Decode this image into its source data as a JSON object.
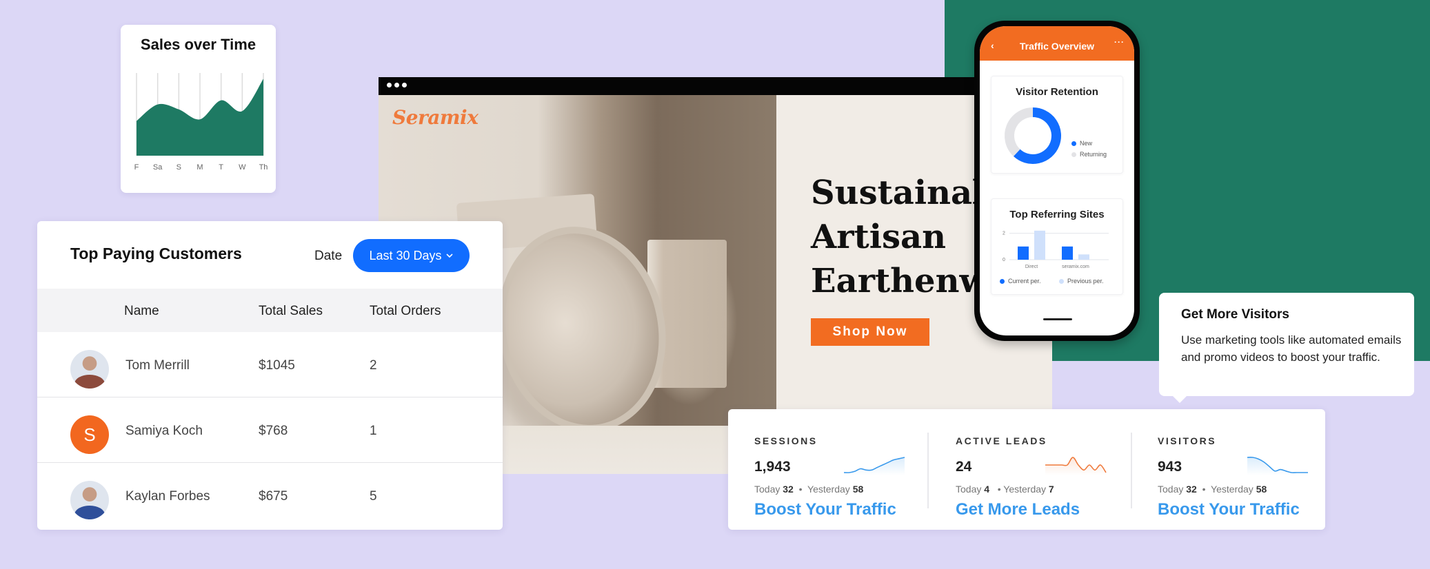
{
  "colors": {
    "background": "#dcd7f6",
    "green_block": "#1e7a63",
    "brand_orange": "#f26c21",
    "primary_blue": "#116dff",
    "link_blue": "#3899ec",
    "area_green": "#1e7a63"
  },
  "sales_card": {
    "title": "Sales over Time",
    "chart_data": {
      "type": "area",
      "title": "Sales over Time",
      "categories": [
        "F",
        "Sa",
        "S",
        "M",
        "T",
        "W",
        "Th"
      ],
      "values": [
        42,
        62,
        56,
        44,
        67,
        54,
        93
      ],
      "ylim": [
        0,
        100
      ],
      "grid": "vertical",
      "xlabel": "",
      "ylabel": ""
    }
  },
  "website": {
    "window_icon": "three-dots-icon",
    "logo": "Seramix",
    "hero_lines": [
      "Sustainable",
      "Artisan",
      "Earthenware"
    ],
    "cta_label": "Shop Now"
  },
  "phone": {
    "header_title": "Traffic Overview",
    "back_icon": "‹",
    "more_icon": "···",
    "retention": {
      "title": "Visitor Retention",
      "chart_data": {
        "type": "pie",
        "title": "Visitor Retention",
        "categories": [
          "New",
          "Returning"
        ],
        "values": [
          62,
          38
        ],
        "colors": [
          "#116dff",
          "#e3e3e6"
        ]
      }
    },
    "referring": {
      "title": "Top Referring Sites",
      "chart_data": {
        "type": "bar",
        "title": "Top Referring Sites",
        "categories": [
          "Direct",
          "seramix.com"
        ],
        "series": [
          {
            "name": "Current per.",
            "values": [
              1,
              1
            ],
            "color": "#116dff"
          },
          {
            "name": "Previous per.",
            "values": [
              2.2,
              0.4
            ],
            "color": "#cfe0fb"
          }
        ],
        "y_ticks": [
          "0",
          "2"
        ],
        "ylim": [
          0,
          2.4
        ]
      }
    }
  },
  "tooltip": {
    "title": "Get More Visitors",
    "body": "Use marketing tools like automated emails and promo videos to boost your traffic."
  },
  "customers": {
    "title": "Top Paying Customers",
    "date_label": "Date",
    "date_value": "Last 30 Days",
    "columns": [
      "Name",
      "Total Sales",
      "Total Orders"
    ],
    "rows": [
      {
        "avatar": "photo",
        "avatar_letter": "",
        "name": "Tom Merrill",
        "sales": "$1045",
        "orders": "2"
      },
      {
        "avatar": "letter",
        "avatar_letter": "S",
        "name": "Samiya Koch",
        "sales": "$768",
        "orders": "1"
      },
      {
        "avatar": "photo",
        "avatar_letter": "",
        "name": "Kaylan Forbes",
        "sales": "$675",
        "orders": "5"
      }
    ]
  },
  "stats": [
    {
      "label": "SESSIONS",
      "value": "1,943",
      "today_label": "Today",
      "today": "32",
      "yesterday_label": "Yesterday",
      "yesterday": "58",
      "link": "Boost Your Traffic",
      "trend_color": "#3899ec",
      "trend": [
        3,
        3,
        4,
        6,
        5,
        5,
        7,
        9,
        11,
        13,
        14,
        15
      ]
    },
    {
      "label": "ACTIVE LEADS",
      "value": "24",
      "today_label": "Today",
      "today": "4",
      "yesterday_label": "Yesterday",
      "yesterday": "7",
      "link": "Get More Leads",
      "trend_color": "#ef7a3c",
      "trend": [
        9,
        9,
        9,
        9,
        9,
        12,
        9,
        7,
        9,
        7,
        9,
        6
      ]
    },
    {
      "label": "VISITORS",
      "value": "943",
      "today_label": "Today",
      "today": "32",
      "yesterday_label": "Yesterday",
      "yesterday": "58",
      "link": "Boost Your Traffic",
      "trend_color": "#3899ec",
      "trend": [
        15,
        15,
        14,
        12,
        9,
        6,
        7,
        6,
        5,
        5,
        5,
        5
      ]
    }
  ]
}
